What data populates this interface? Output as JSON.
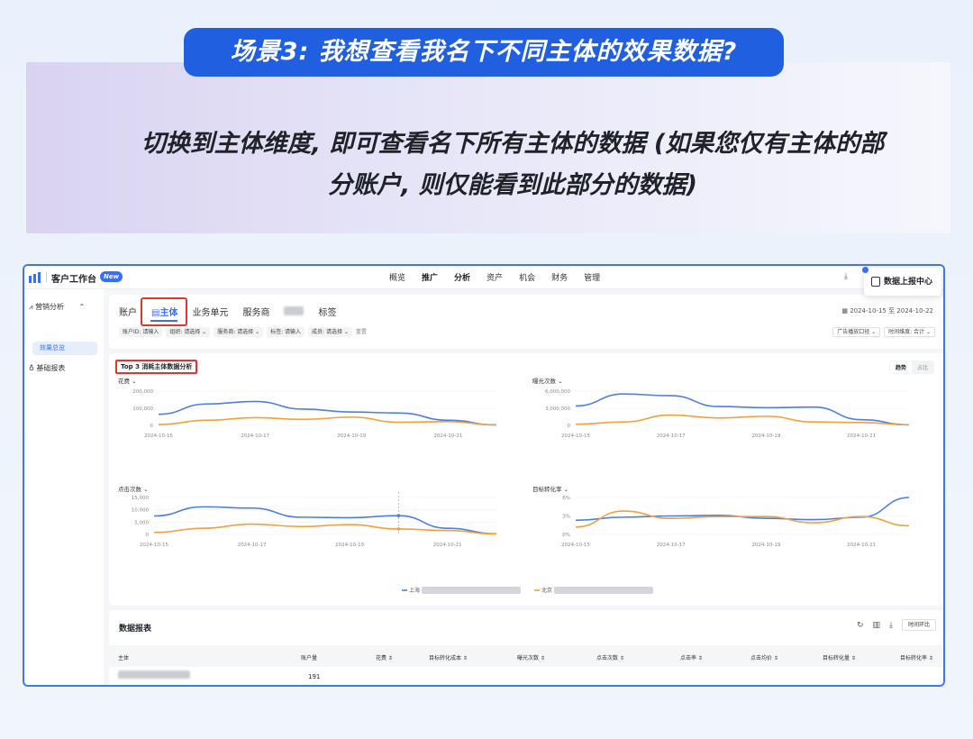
{
  "banner": {
    "title": "场景3: 我想查看我名下不同主体的效果数据?",
    "desc_line1": "切换到主体维度, 即可查看名下所有主体的数据 (如果您仅有主体的部",
    "desc_line2": "分账户, 则仅能看到此部分的数据)"
  },
  "topbar": {
    "app_name": "客户工作台",
    "new_badge": "New",
    "nav": [
      "概览",
      "推广",
      "分析",
      "资产",
      "机会",
      "财务",
      "管理"
    ],
    "active_nav": [
      "推广",
      "分析"
    ],
    "report_center": "数据上报中心"
  },
  "sidebar": {
    "section": "营销分析",
    "sub_active": "效果总览",
    "item2": "基础报表"
  },
  "tabs": [
    "账户",
    "主体",
    "业务单元",
    "服务商",
    "标签"
  ],
  "date_range": "2024-10-15 至 2024-10-22",
  "filters": [
    "账户ID: 请输入",
    "组织: 请选择 ⌄",
    "服务商: 请选择 ⌄",
    "标签: 请输入",
    "成员: 请选择 ⌄"
  ],
  "reset": "重置",
  "filters_right": [
    "广告播放口径 ⌄",
    "时间维度: 合计 ⌄"
  ],
  "chart_panel": {
    "title": "Top 3 消耗主体数据分析",
    "seg": [
      "趋势",
      "占比"
    ],
    "legend": [
      "上海",
      "北京"
    ]
  },
  "colors": {
    "series1": "#4a7fe0",
    "series2": "#f2a03d",
    "accent": "#3370ff",
    "highlight": "#e0362f"
  },
  "chart_data": [
    {
      "type": "line",
      "title": "花费",
      "x": [
        "2024-10-15",
        "2024-10-16",
        "2024-10-17",
        "2024-10-18",
        "2024-10-19",
        "2024-10-20",
        "2024-10-21",
        "2024-10-22"
      ],
      "xticks": [
        "2024-10-15",
        "2024-10-17",
        "2024-10-19",
        "2024-10-21"
      ],
      "yticks": [
        "0",
        "100,000",
        "200,000"
      ],
      "ylim": [
        0,
        200000
      ],
      "series": [
        {
          "name": "上海",
          "values": [
            65000,
            125000,
            140000,
            95000,
            78000,
            72000,
            30000,
            3000
          ]
        },
        {
          "name": "北京",
          "values": [
            5000,
            30000,
            45000,
            35000,
            48000,
            18000,
            22000,
            2000
          ]
        }
      ]
    },
    {
      "type": "line",
      "title": "曝光次数",
      "x": [
        "2024-10-15",
        "2024-10-16",
        "2024-10-17",
        "2024-10-18",
        "2024-10-19",
        "2024-10-20",
        "2024-10-21",
        "2024-10-22"
      ],
      "xticks": [
        "2024-10-15",
        "2024-10-17",
        "2024-10-19",
        "2024-10-21"
      ],
      "yticks": [
        "0",
        "3,000,000",
        "6,000,000"
      ],
      "ylim": [
        0,
        6000000
      ],
      "series": [
        {
          "name": "上海",
          "values": [
            3400000,
            5500000,
            5200000,
            3300000,
            3100000,
            3200000,
            1000000,
            100000
          ]
        },
        {
          "name": "北京",
          "values": [
            200000,
            600000,
            1800000,
            1300000,
            1600000,
            600000,
            500000,
            100000
          ]
        }
      ]
    },
    {
      "type": "line",
      "title": "点击次数",
      "x": [
        "2024-10-15",
        "2024-10-16",
        "2024-10-17",
        "2024-10-18",
        "2024-10-19",
        "2024-10-20",
        "2024-10-21",
        "2024-10-22"
      ],
      "xticks": [
        "2024-10-15",
        "2024-10-17",
        "2024-10-19",
        "2024-10-21"
      ],
      "yticks": [
        "0",
        "5,000",
        "10,000",
        "15,000"
      ],
      "ylim": [
        0,
        15000
      ],
      "series": [
        {
          "name": "上海",
          "values": [
            7500,
            11200,
            10700,
            7000,
            6800,
            7600,
            2500,
            300
          ]
        },
        {
          "name": "北京",
          "values": [
            800,
            2500,
            4200,
            3200,
            4000,
            2200,
            1600,
            200
          ]
        }
      ]
    },
    {
      "type": "line",
      "title": "目标转化率",
      "x": [
        "2024-10-15",
        "2024-10-16",
        "2024-10-17",
        "2024-10-18",
        "2024-10-19",
        "2024-10-20",
        "2024-10-21",
        "2024-10-22"
      ],
      "xticks": [
        "2024-10-15",
        "2024-10-17",
        "2024-10-19",
        "2024-10-21"
      ],
      "yticks": [
        "0%",
        "3%",
        "6%"
      ],
      "ylim": [
        0,
        6
      ],
      "series": [
        {
          "name": "上海",
          "values": [
            2.3,
            2.8,
            3.0,
            3.1,
            2.6,
            2.4,
            2.8,
            6.0
          ]
        },
        {
          "name": "北京",
          "values": [
            1.2,
            3.8,
            2.6,
            2.9,
            2.9,
            1.9,
            2.9,
            1.4
          ]
        }
      ]
    }
  ],
  "table": {
    "title": "数据报表",
    "compare_btn": "时间环比",
    "columns": [
      "主体",
      "账户量",
      "花费 ⇕",
      "目标转化成本 ⇕",
      "曝光次数 ⇕",
      "点击次数 ⇕",
      "点击率 ⇕",
      "点击均价 ⇕",
      "目标转化量 ⇕",
      "目标转化率 ⇕"
    ],
    "rows": [
      {
        "account_count": "191"
      }
    ]
  }
}
